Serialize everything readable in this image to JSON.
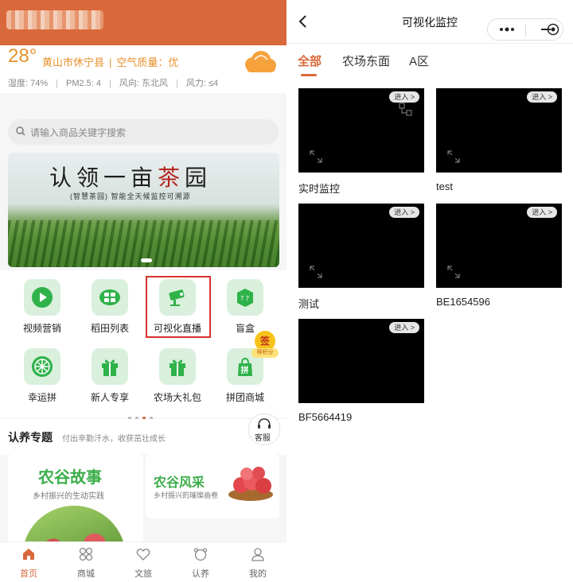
{
  "left": {
    "weather": {
      "temp": "28°",
      "city": "黄山市休宁县",
      "air": "空气质量：优",
      "humidity": "湿度: 74%",
      "pm": "PM2.5: 4",
      "wind_dir": "风向: 东北风",
      "wind_force": "风力: ≤4",
      "icon": "cloud-icon"
    },
    "search": {
      "placeholder": "请输入商品关键字搜索"
    },
    "banner": {
      "title_a": "认领一亩",
      "title_b": "茶",
      "title_c": "园",
      "subtitle": "(智慧茶园) 智能全天候监控可溯源"
    },
    "icons": [
      {
        "label": "视频营销",
        "icon": "play-icon"
      },
      {
        "label": "稻田列表",
        "icon": "field-grid-icon"
      },
      {
        "label": "可视化直播",
        "icon": "camera-icon"
      },
      {
        "label": "盲盒",
        "icon": "mystery-box-icon"
      },
      {
        "label": "幸运拼",
        "icon": "lucky-wheel-icon"
      },
      {
        "label": "新人专享",
        "icon": "gift-icon"
      },
      {
        "label": "农场大礼包",
        "icon": "gift-pack-icon"
      },
      {
        "label": "拼团商城",
        "icon": "group-buy-icon"
      }
    ],
    "signin": {
      "top": "签",
      "bottom": "得积分"
    },
    "section": {
      "title": "认养专题",
      "subtitle": "付出辛勤汗水，收获茁壮成长",
      "service": "客服"
    },
    "cards": [
      {
        "title": "农谷故事",
        "subtitle": "乡村振兴的生动实践"
      },
      {
        "title": "农谷风采",
        "subtitle": "乡村振兴的璀璨画卷"
      }
    ],
    "tabbar": [
      {
        "label": "首页",
        "icon": "home-icon",
        "active": true
      },
      {
        "label": "商城",
        "icon": "shop-icon",
        "active": false
      },
      {
        "label": "文旅",
        "icon": "heart-icon",
        "active": false
      },
      {
        "label": "认养",
        "icon": "adopt-icon",
        "active": false
      },
      {
        "label": "我的",
        "icon": "user-icon",
        "active": false
      }
    ],
    "accent": "#d9683a"
  },
  "right": {
    "title": "可视化监控",
    "tabs": [
      {
        "label": "全部",
        "active": true
      },
      {
        "label": "农场东面",
        "active": false
      },
      {
        "label": "A区",
        "active": false
      }
    ],
    "cameras": [
      {
        "label": "实时监控",
        "enter": "进入 >"
      },
      {
        "label": "test",
        "enter": "进入 >"
      },
      {
        "label": "测试",
        "enter": "进入 >"
      },
      {
        "label": "BE1654596",
        "enter": "进入 >"
      },
      {
        "label": "BF5664419",
        "enter": "进入 >"
      }
    ]
  }
}
